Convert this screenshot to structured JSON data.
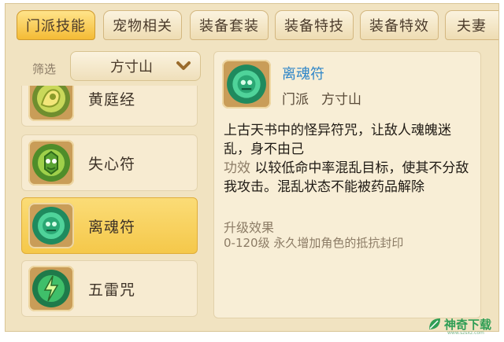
{
  "tabs": [
    {
      "label": "门派技能",
      "active": true
    },
    {
      "label": "宠物相关",
      "active": false
    },
    {
      "label": "装备套装",
      "active": false
    },
    {
      "label": "装备特技",
      "active": false
    },
    {
      "label": "装备特效",
      "active": false
    },
    {
      "label": "夫妻",
      "active": false
    }
  ],
  "filter": {
    "label": "筛选",
    "value": "方寸山",
    "icon": "chevron-down-icon"
  },
  "skills": [
    {
      "name": "黄庭经",
      "icon": "huangtingjing-skill-icon"
    },
    {
      "name": "失心符",
      "icon": "shixinfu-skill-icon"
    },
    {
      "name": "离魂符",
      "icon": "lihunfu-skill-icon",
      "selected": true
    },
    {
      "name": "五雷咒",
      "icon": "wuleizhou-skill-icon"
    }
  ],
  "detail": {
    "name": "离魂符",
    "sect_label": "门派",
    "sect_value": "方寸山",
    "description": "上古天书中的怪异符咒，让敌人魂魄迷乱，身不由己",
    "effect_label": "功效",
    "effect_text": "以较低命中率混乱目标，使其不分敌我攻击。混乱状态不能被药品解除",
    "upgrade_title": "升级效果",
    "upgrade_text": "0-120级 永久增加角色的抵抗封印"
  },
  "watermark": {
    "text": "神奇下载",
    "url": "www.szsxz.com"
  },
  "colors": {
    "panel_bg": "#f1e3c1",
    "tab_active": "#f4bb35",
    "selected_row": "#f7cf5a",
    "skill_name_blue": "#2f86c8"
  }
}
